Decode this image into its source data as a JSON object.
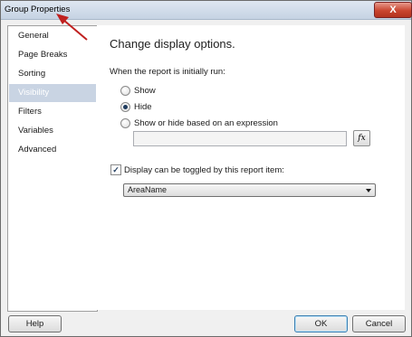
{
  "window": {
    "title": "Group Properties",
    "close_label": "X"
  },
  "sidebar": {
    "items": [
      {
        "label": "General",
        "selected": false
      },
      {
        "label": "Page Breaks",
        "selected": false
      },
      {
        "label": "Sorting",
        "selected": false
      },
      {
        "label": "Visibility",
        "selected": true
      },
      {
        "label": "Filters",
        "selected": false
      },
      {
        "label": "Variables",
        "selected": false
      },
      {
        "label": "Advanced",
        "selected": false
      }
    ]
  },
  "main": {
    "heading": "Change display options.",
    "initial_run_label": "When the report is initially run:",
    "radios": [
      {
        "label": "Show",
        "checked": false
      },
      {
        "label": "Hide",
        "checked": true
      },
      {
        "label": "Show or hide based on an expression",
        "checked": false
      }
    ],
    "expression_value": "",
    "fx_label": "fx",
    "toggle_checkbox": {
      "label": "Display can be toggled by this report item:",
      "checked": true
    },
    "toggle_item": {
      "selected": "AreaName"
    }
  },
  "footer": {
    "help_label": "Help",
    "ok_label": "OK",
    "cancel_label": "Cancel"
  },
  "colors": {
    "selected_nav": "#c9d4e3",
    "annotation_arrow": "#c0201f"
  }
}
